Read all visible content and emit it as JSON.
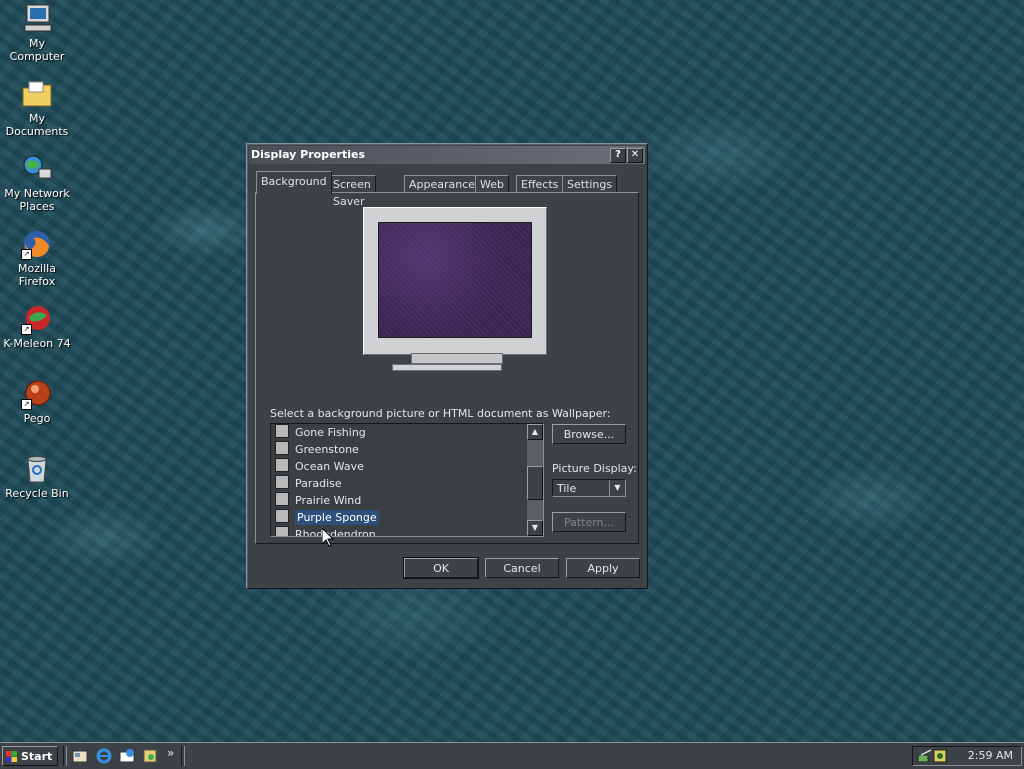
{
  "desktop": {
    "icons": [
      {
        "label_line1": "My Computer",
        "label_line2": ""
      },
      {
        "label_line1": "My Documents",
        "label_line2": ""
      },
      {
        "label_line1": "My Network",
        "label_line2": "Places"
      },
      {
        "label_line1": "Mozilla Firefox",
        "label_line2": ""
      },
      {
        "label_line1": "K-Meleon 74",
        "label_line2": ""
      },
      {
        "label_line1": "Pego",
        "label_line2": ""
      },
      {
        "label_line1": "Recycle Bin",
        "label_line2": ""
      }
    ]
  },
  "dialog": {
    "title": "Display Properties",
    "help_glyph": "?",
    "close_glyph": "✕",
    "tabs": [
      "Background",
      "Screen Saver",
      "Appearance",
      "Web",
      "Effects",
      "Settings"
    ],
    "active_tab": "Background",
    "wallpaper_label": "Select a background picture or HTML document as Wallpaper:",
    "wallpaper_list": [
      "Gone Fishing",
      "Greenstone",
      "Ocean Wave",
      "Paradise",
      "Prairie Wind",
      "Purple Sponge",
      "Rhododendron"
    ],
    "selected_wallpaper": "Purple Sponge",
    "browse_label": "Browse...",
    "picture_display_label": "Picture Display:",
    "picture_display_value": "Tile",
    "pattern_label": "Pattern...",
    "ok_label": "OK",
    "cancel_label": "Cancel",
    "apply_label": "Apply"
  },
  "taskbar": {
    "start_label": "Start",
    "quicklaunch_more": "»",
    "clock": "2:59 AM"
  },
  "colors": {
    "desktop_bg": "#1e4a57",
    "dialog_face": "#3d4247",
    "selection": "#2d4f7a",
    "preview_wallpaper": "#3a2350"
  }
}
